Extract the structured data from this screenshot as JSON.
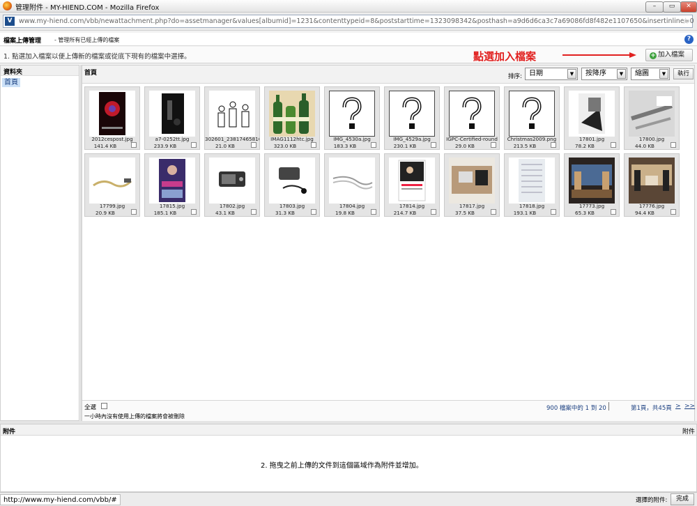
{
  "window": {
    "title": "管理附件 - MY-HIEND.COM - Mozilla Firefox",
    "min_glyph": "–",
    "max_glyph": "▭",
    "close_glyph": "✕"
  },
  "address": {
    "url": "www.my-hiend.com/vbb/newattachment.php?do=assetmanager&values[albumid]=1231&contenttypeid=8&poststarttime=1323098342&posthash=a9d6d6ca3c7a69086fd8f482e1107650&insertinline=0",
    "site_glyph": "V",
    "star_glyph": "☆"
  },
  "header": {
    "title": "檔案上傳管理",
    "subtitle": "- 管理所有已經上傳的檔案",
    "help_glyph": "?"
  },
  "instructions": {
    "text": "1. 點選加入檔案以便上傳新的檔案或從底下現有的檔案中選擇。",
    "annotation": "點選加入檔案",
    "add_button": "加入檔案",
    "accent": "#e1201f"
  },
  "folders": {
    "title": "資料夾",
    "items": [
      {
        "label": "首頁"
      }
    ]
  },
  "toolbar": {
    "breadcrumb": "首頁",
    "sort_label": "排序:",
    "sort_value": "日期",
    "order_value": "按降序",
    "view_value": "縮圖",
    "exec_button": "執行",
    "arrow_glyph": "▼"
  },
  "files": [
    {
      "name": "2012cespost.jpg",
      "size": "141.4 KB",
      "thumb": "poster"
    },
    {
      "name": "a7-0252tt.jpg",
      "size": "233.9 KB",
      "thumb": "dark"
    },
    {
      "name": "302601_238174658166",
      "size": "21.0 KB",
      "thumb": "sketch"
    },
    {
      "name": "IMAG1112htc.jpg",
      "size": "323.0 KB",
      "thumb": "bottles"
    },
    {
      "name": "IMG_4530a.jpg",
      "size": "183.3 KB",
      "thumb": "unknown"
    },
    {
      "name": "IMG_4529a.jpg",
      "size": "230.1 KB",
      "thumb": "unknown"
    },
    {
      "name": "IGPC-Certified-round",
      "size": "29.0 KB",
      "thumb": "unknown"
    },
    {
      "name": "Christmas2009.png",
      "size": "213.5 KB",
      "thumb": "unknown"
    },
    {
      "name": "17801.jpg",
      "size": "78.2 KB",
      "thumb": "bw"
    },
    {
      "name": "17800.jpg",
      "size": "44.0 KB",
      "thumb": "bw2"
    },
    {
      "name": "17799.jpg",
      "size": "20.9 KB",
      "thumb": "cable"
    },
    {
      "name": "17815.jpg",
      "size": "185.1 KB",
      "thumb": "purple"
    },
    {
      "name": "17802.jpg",
      "size": "43.1 KB",
      "thumb": "device"
    },
    {
      "name": "17803.jpg",
      "size": "31.3 KB",
      "thumb": "device2"
    },
    {
      "name": "17804.jpg",
      "size": "19.8 KB",
      "thumb": "cable2"
    },
    {
      "name": "17814.jpg",
      "size": "214.7 KB",
      "thumb": "piano"
    },
    {
      "name": "17817.jpg",
      "size": "37.5 KB",
      "thumb": "room"
    },
    {
      "name": "17818.jpg",
      "size": "193.1 KB",
      "thumb": "paper"
    },
    {
      "name": "17773.jpg",
      "size": "65.3 KB",
      "thumb": "room2"
    },
    {
      "name": "17776.jpg",
      "size": "94.4 KB",
      "thumb": "room3"
    }
  ],
  "footer": {
    "select_all": "全選",
    "note": "一小時內沒有使用上傳的檔案將會被刪除",
    "count": "900 檔案中的 1 到 20",
    "page_info": "第1頁，共45頁",
    "next": ">",
    "last": ">>"
  },
  "attachments": {
    "title": "附件",
    "right_label": "附件",
    "drop_message": "2. 拖曳之前上傳的文件到這個區域作為附件並增加。"
  },
  "statusbar": {
    "url": "http://www.my-hiend.com/vbb/#",
    "selected_label": "選擇的附件:",
    "done_button": "完成"
  }
}
